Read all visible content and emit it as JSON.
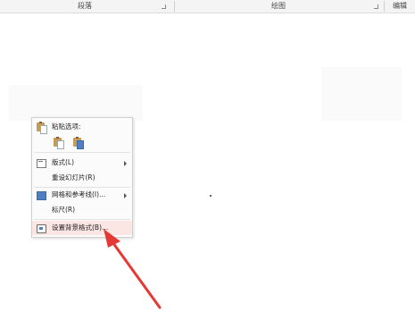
{
  "ribbon": {
    "groups": [
      {
        "label": "段落"
      },
      {
        "label": "绘图"
      },
      {
        "label": "编辑"
      }
    ]
  },
  "context_menu": {
    "paste_header": "粘贴选项:",
    "items": [
      {
        "label": "版式(L)",
        "icon": "layout-icon",
        "submenu": true
      },
      {
        "label": "重设幻灯片(R)",
        "icon": "",
        "submenu": false
      },
      {
        "label": "网格和参考线(I)...",
        "icon": "grid-icon",
        "submenu": true
      },
      {
        "label": "标尺(R)",
        "icon": "",
        "submenu": false
      },
      {
        "label": "设置背景格式(B)...",
        "icon": "format-background-icon",
        "submenu": false,
        "highlighted": true
      }
    ]
  },
  "colors": {
    "annotation_arrow": "#e53935",
    "highlight": "#fbe6e3"
  }
}
